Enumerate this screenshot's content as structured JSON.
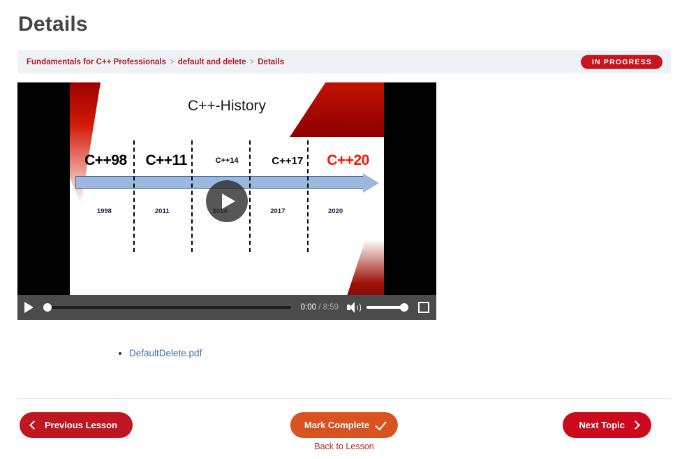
{
  "header": {
    "title": "Details"
  },
  "breadcrumb": {
    "separator": ">",
    "items": [
      {
        "label": "Fundamentals for C++ Professionals"
      },
      {
        "label": "default and delete"
      },
      {
        "label": "Details"
      }
    ],
    "status_badge": "IN PROGRESS"
  },
  "video": {
    "slide": {
      "title": "C++-History",
      "versions": [
        {
          "label": "C++98",
          "year": "1998",
          "size": "lg",
          "color": "black"
        },
        {
          "label": "C++11",
          "year": "2011",
          "size": "lg",
          "color": "black"
        },
        {
          "label": "C++14",
          "year": "2014",
          "size": "sm",
          "color": "black"
        },
        {
          "label": "C++17",
          "year": "2017",
          "size": "md",
          "color": "black"
        },
        {
          "label": "C++20",
          "year": "2020",
          "size": "lg",
          "color": "red"
        }
      ]
    },
    "controls": {
      "current_time": "0:00",
      "time_separator": "/",
      "total_time": "8:59",
      "progress_percent": 0,
      "volume_percent": 100
    }
  },
  "materials": {
    "items": [
      {
        "label": "DefaultDelete.pdf"
      }
    ]
  },
  "navigation": {
    "previous_label": "Previous Lesson",
    "complete_label": "Mark Complete",
    "next_label": "Next Topic",
    "back_link_label": "Back to Lesson"
  },
  "colors": {
    "badge_red": "#c7141f",
    "prev_red": "#bf1622",
    "complete_orange": "#d8531f",
    "next_red": "#cc0a1e",
    "crumb_red": "#b31b2c",
    "link_blue": "#3b6db5",
    "timeline_blue": "#9cb8dc"
  }
}
